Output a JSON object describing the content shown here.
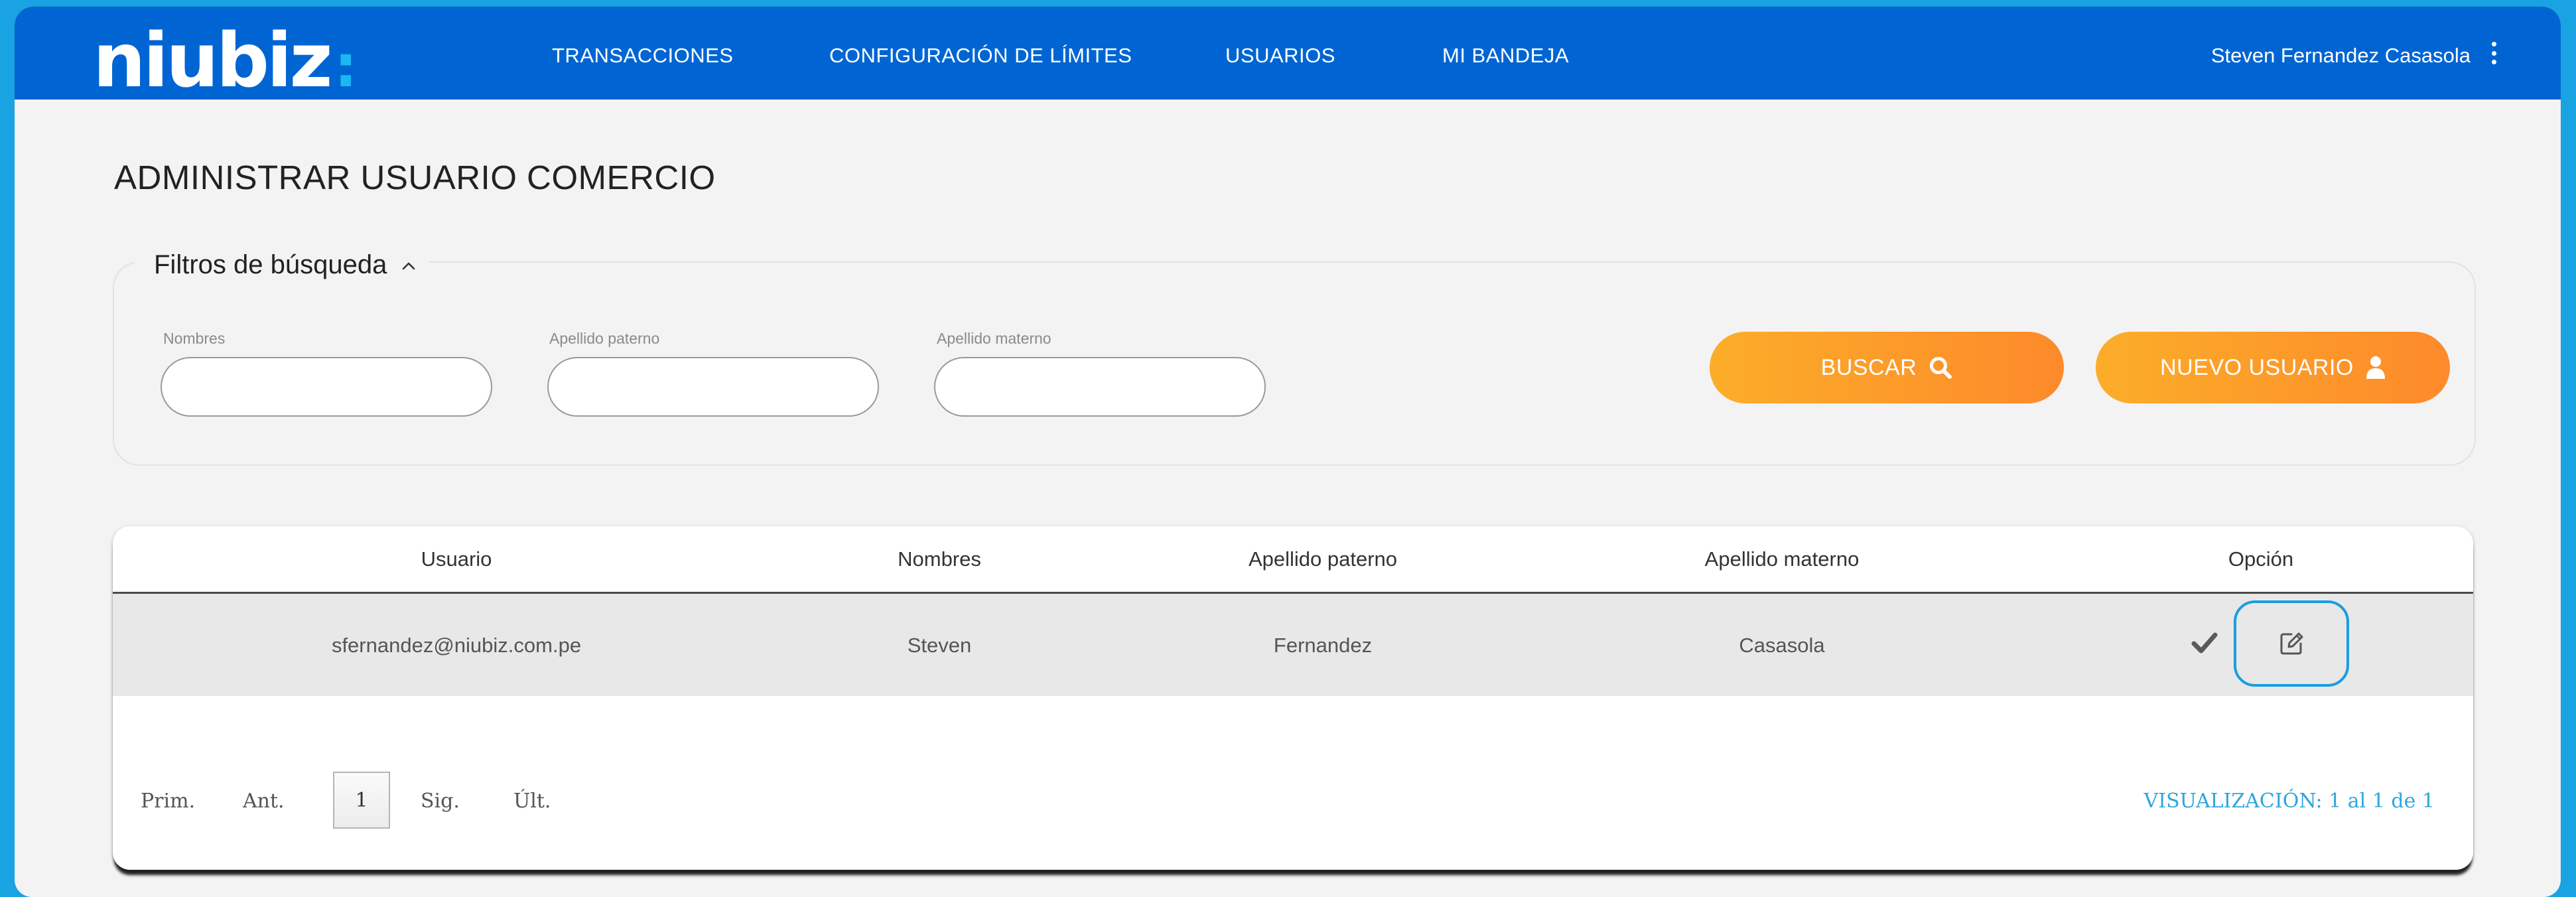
{
  "brand": {
    "logo_text": "niubiz",
    "logo_colon": ":"
  },
  "nav": {
    "items": [
      {
        "label": "TRANSACCIONES"
      },
      {
        "label": "CONFIGURACIÓN DE LÍMITES"
      },
      {
        "label": "USUARIOS"
      },
      {
        "label": "MI BANDEJA"
      }
    ],
    "user_name": "Steven Fernandez Casasola"
  },
  "page": {
    "title": "ADMINISTRAR USUARIO COMERCIO"
  },
  "filters": {
    "legend": "Filtros de búsqueda",
    "fields": [
      {
        "label": "Nombres",
        "value": "",
        "placeholder": ""
      },
      {
        "label": "Apellido paterno",
        "value": "",
        "placeholder": ""
      },
      {
        "label": "Apellido materno",
        "value": "",
        "placeholder": ""
      }
    ],
    "search_label": "BUSCAR",
    "new_user_label": "NUEVO USUARIO"
  },
  "table": {
    "headers": [
      "Usuario",
      "Nombres",
      "Apellido paterno",
      "Apellido materno",
      "Opción"
    ],
    "rows": [
      {
        "usuario": "sfernandez@niubiz.com.pe",
        "nombres": "Steven",
        "apellido_paterno": "Fernandez",
        "apellido_materno": "Casasola"
      }
    ]
  },
  "pagination": {
    "first": "Prim.",
    "prev": "Ant.",
    "current_page": "1",
    "next": "Sig.",
    "last": "Últ.",
    "summary": "VISUALIZACIÓN: 1 al 1 de 1"
  },
  "icons": {
    "search": "search-icon",
    "new_user": "user-icon",
    "check": "check-icon",
    "edit": "edit-icon",
    "menu": "kebab-menu-icon",
    "collapse": "chevron-up-icon"
  },
  "colors": {
    "navbar": "#0065d3",
    "accent_orange": "#fd9a2a",
    "accent_blue": "#1a9de0",
    "page_background": "#f3f3f3"
  }
}
